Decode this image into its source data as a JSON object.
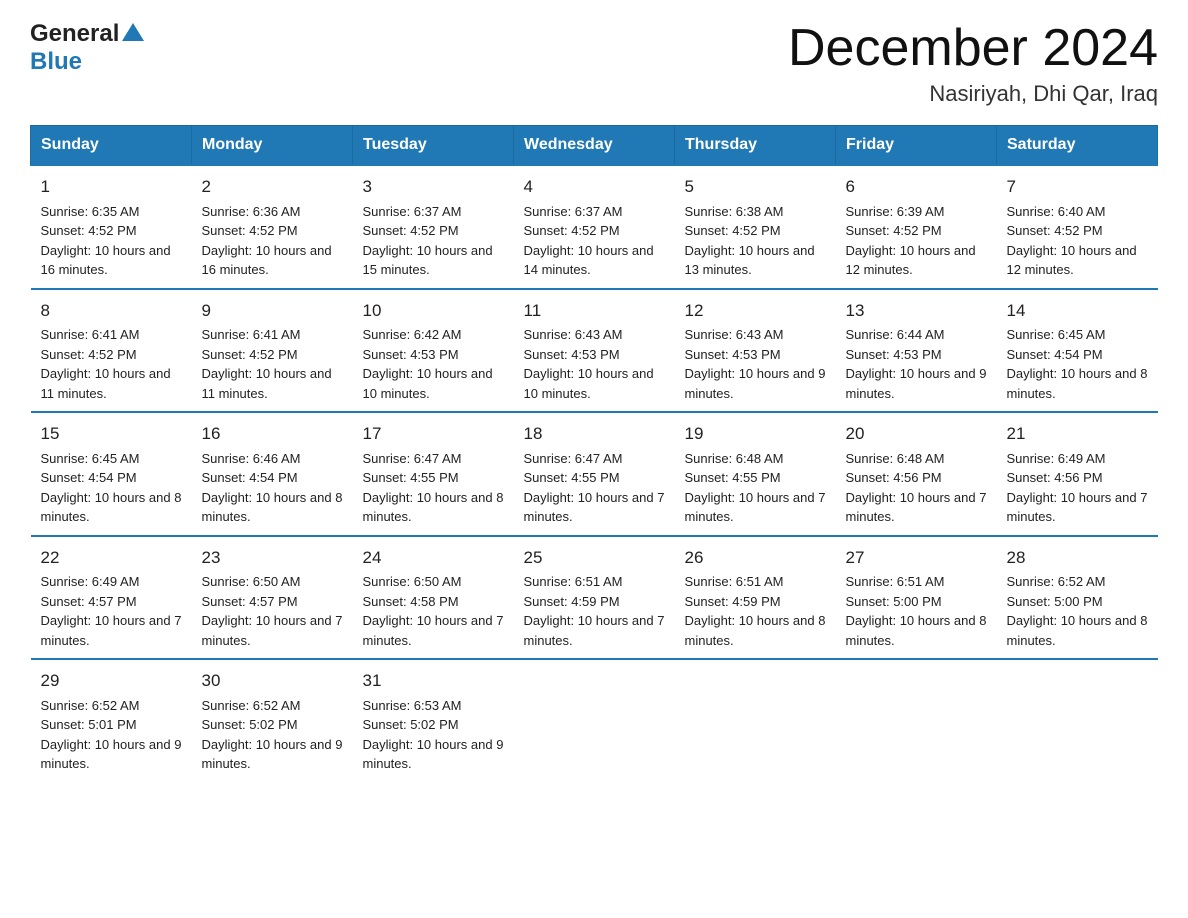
{
  "header": {
    "logo_general": "General",
    "logo_blue": "Blue",
    "main_title": "December 2024",
    "subtitle": "Nasiriyah, Dhi Qar, Iraq"
  },
  "days_of_week": [
    "Sunday",
    "Monday",
    "Tuesday",
    "Wednesday",
    "Thursday",
    "Friday",
    "Saturday"
  ],
  "weeks": [
    [
      {
        "day": "1",
        "sunrise": "Sunrise: 6:35 AM",
        "sunset": "Sunset: 4:52 PM",
        "daylight": "Daylight: 10 hours and 16 minutes."
      },
      {
        "day": "2",
        "sunrise": "Sunrise: 6:36 AM",
        "sunset": "Sunset: 4:52 PM",
        "daylight": "Daylight: 10 hours and 16 minutes."
      },
      {
        "day": "3",
        "sunrise": "Sunrise: 6:37 AM",
        "sunset": "Sunset: 4:52 PM",
        "daylight": "Daylight: 10 hours and 15 minutes."
      },
      {
        "day": "4",
        "sunrise": "Sunrise: 6:37 AM",
        "sunset": "Sunset: 4:52 PM",
        "daylight": "Daylight: 10 hours and 14 minutes."
      },
      {
        "day": "5",
        "sunrise": "Sunrise: 6:38 AM",
        "sunset": "Sunset: 4:52 PM",
        "daylight": "Daylight: 10 hours and 13 minutes."
      },
      {
        "day": "6",
        "sunrise": "Sunrise: 6:39 AM",
        "sunset": "Sunset: 4:52 PM",
        "daylight": "Daylight: 10 hours and 12 minutes."
      },
      {
        "day": "7",
        "sunrise": "Sunrise: 6:40 AM",
        "sunset": "Sunset: 4:52 PM",
        "daylight": "Daylight: 10 hours and 12 minutes."
      }
    ],
    [
      {
        "day": "8",
        "sunrise": "Sunrise: 6:41 AM",
        "sunset": "Sunset: 4:52 PM",
        "daylight": "Daylight: 10 hours and 11 minutes."
      },
      {
        "day": "9",
        "sunrise": "Sunrise: 6:41 AM",
        "sunset": "Sunset: 4:52 PM",
        "daylight": "Daylight: 10 hours and 11 minutes."
      },
      {
        "day": "10",
        "sunrise": "Sunrise: 6:42 AM",
        "sunset": "Sunset: 4:53 PM",
        "daylight": "Daylight: 10 hours and 10 minutes."
      },
      {
        "day": "11",
        "sunrise": "Sunrise: 6:43 AM",
        "sunset": "Sunset: 4:53 PM",
        "daylight": "Daylight: 10 hours and 10 minutes."
      },
      {
        "day": "12",
        "sunrise": "Sunrise: 6:43 AM",
        "sunset": "Sunset: 4:53 PM",
        "daylight": "Daylight: 10 hours and 9 minutes."
      },
      {
        "day": "13",
        "sunrise": "Sunrise: 6:44 AM",
        "sunset": "Sunset: 4:53 PM",
        "daylight": "Daylight: 10 hours and 9 minutes."
      },
      {
        "day": "14",
        "sunrise": "Sunrise: 6:45 AM",
        "sunset": "Sunset: 4:54 PM",
        "daylight": "Daylight: 10 hours and 8 minutes."
      }
    ],
    [
      {
        "day": "15",
        "sunrise": "Sunrise: 6:45 AM",
        "sunset": "Sunset: 4:54 PM",
        "daylight": "Daylight: 10 hours and 8 minutes."
      },
      {
        "day": "16",
        "sunrise": "Sunrise: 6:46 AM",
        "sunset": "Sunset: 4:54 PM",
        "daylight": "Daylight: 10 hours and 8 minutes."
      },
      {
        "day": "17",
        "sunrise": "Sunrise: 6:47 AM",
        "sunset": "Sunset: 4:55 PM",
        "daylight": "Daylight: 10 hours and 8 minutes."
      },
      {
        "day": "18",
        "sunrise": "Sunrise: 6:47 AM",
        "sunset": "Sunset: 4:55 PM",
        "daylight": "Daylight: 10 hours and 7 minutes."
      },
      {
        "day": "19",
        "sunrise": "Sunrise: 6:48 AM",
        "sunset": "Sunset: 4:55 PM",
        "daylight": "Daylight: 10 hours and 7 minutes."
      },
      {
        "day": "20",
        "sunrise": "Sunrise: 6:48 AM",
        "sunset": "Sunset: 4:56 PM",
        "daylight": "Daylight: 10 hours and 7 minutes."
      },
      {
        "day": "21",
        "sunrise": "Sunrise: 6:49 AM",
        "sunset": "Sunset: 4:56 PM",
        "daylight": "Daylight: 10 hours and 7 minutes."
      }
    ],
    [
      {
        "day": "22",
        "sunrise": "Sunrise: 6:49 AM",
        "sunset": "Sunset: 4:57 PM",
        "daylight": "Daylight: 10 hours and 7 minutes."
      },
      {
        "day": "23",
        "sunrise": "Sunrise: 6:50 AM",
        "sunset": "Sunset: 4:57 PM",
        "daylight": "Daylight: 10 hours and 7 minutes."
      },
      {
        "day": "24",
        "sunrise": "Sunrise: 6:50 AM",
        "sunset": "Sunset: 4:58 PM",
        "daylight": "Daylight: 10 hours and 7 minutes."
      },
      {
        "day": "25",
        "sunrise": "Sunrise: 6:51 AM",
        "sunset": "Sunset: 4:59 PM",
        "daylight": "Daylight: 10 hours and 7 minutes."
      },
      {
        "day": "26",
        "sunrise": "Sunrise: 6:51 AM",
        "sunset": "Sunset: 4:59 PM",
        "daylight": "Daylight: 10 hours and 8 minutes."
      },
      {
        "day": "27",
        "sunrise": "Sunrise: 6:51 AM",
        "sunset": "Sunset: 5:00 PM",
        "daylight": "Daylight: 10 hours and 8 minutes."
      },
      {
        "day": "28",
        "sunrise": "Sunrise: 6:52 AM",
        "sunset": "Sunset: 5:00 PM",
        "daylight": "Daylight: 10 hours and 8 minutes."
      }
    ],
    [
      {
        "day": "29",
        "sunrise": "Sunrise: 6:52 AM",
        "sunset": "Sunset: 5:01 PM",
        "daylight": "Daylight: 10 hours and 9 minutes."
      },
      {
        "day": "30",
        "sunrise": "Sunrise: 6:52 AM",
        "sunset": "Sunset: 5:02 PM",
        "daylight": "Daylight: 10 hours and 9 minutes."
      },
      {
        "day": "31",
        "sunrise": "Sunrise: 6:53 AM",
        "sunset": "Sunset: 5:02 PM",
        "daylight": "Daylight: 10 hours and 9 minutes."
      },
      null,
      null,
      null,
      null
    ]
  ]
}
